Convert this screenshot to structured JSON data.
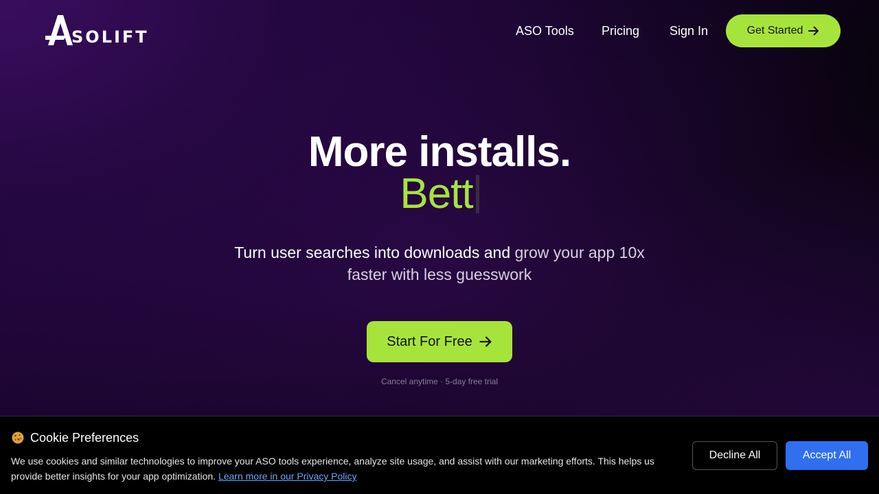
{
  "brand": {
    "name": "SOLIFT",
    "accent_color": "#a6e43c"
  },
  "nav": {
    "links": [
      "ASO Tools",
      "Pricing",
      "Sign In"
    ],
    "cta_label": "Get Started"
  },
  "hero": {
    "headline": "More installs.",
    "typed_text": "Bett",
    "subtitle_main": "Turn user searches into downloads and",
    "subtitle_muted": "grow your app 10x faster with less guesswork",
    "cta_label": "Start For Free",
    "hint": "Cancel anytime · 5-day free trial"
  },
  "cookie": {
    "title": "Cookie Preferences",
    "body": "We use cookies and similar technologies to improve your ASO tools experience, analyze site usage, and assist with our marketing efforts. This helps us provide better insights for your app optimization.",
    "link_label": "Learn more in our Privacy Policy",
    "decline_label": "Decline All",
    "accept_label": "Accept All",
    "accept_color": "#2f6ff0"
  },
  "icons": {
    "logo": "logo-a-icon",
    "arrow": "arrow-right-icon",
    "cookie": "cookie-icon"
  }
}
